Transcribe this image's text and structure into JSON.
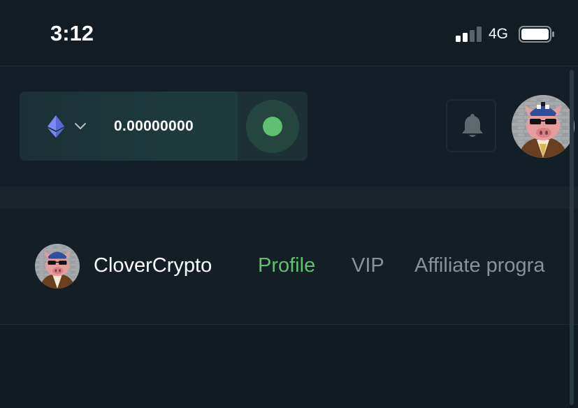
{
  "status_bar": {
    "time": "3:12",
    "network": "4G"
  },
  "wallet": {
    "currency_icon": "ethereum-icon",
    "dropdown_icon": "chevron-down-icon",
    "balance": "0.00000000",
    "deposit_icon": "green-dot-icon"
  },
  "header": {
    "notification_icon": "bell-icon",
    "avatar_icon": "pig-avatar"
  },
  "profile": {
    "username": "CloverCrypto",
    "tabs": [
      {
        "label": "Profile",
        "active": true
      },
      {
        "label": "VIP",
        "active": false
      },
      {
        "label": "Affiliate progra",
        "active": false
      }
    ]
  },
  "colors": {
    "background": "#131f26",
    "accent_green": "#5fbf72",
    "tab_inactive": "#8a9296",
    "eth_blue": "#6f7ff0"
  }
}
